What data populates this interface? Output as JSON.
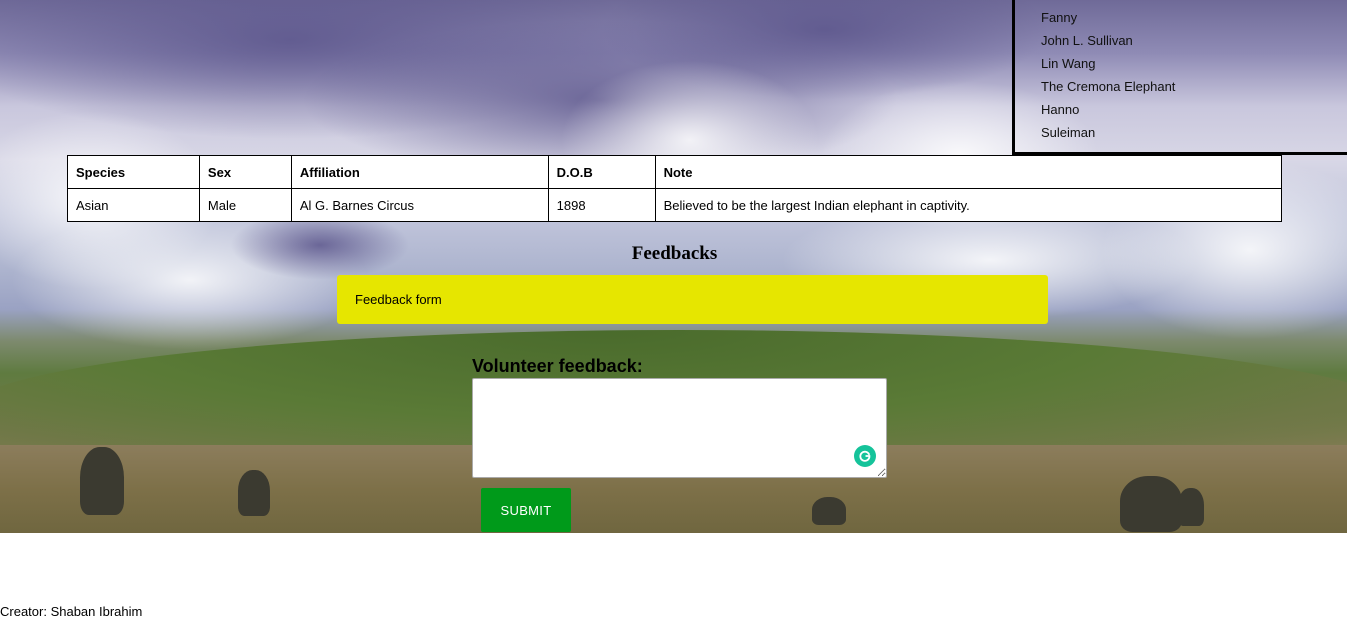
{
  "elephant_names": [
    "Fanny",
    "John L. Sullivan",
    "Lin Wang",
    "The Cremona Elephant",
    "Hanno",
    "Suleiman"
  ],
  "table": {
    "headers": [
      "Species",
      "Sex",
      "Affiliation",
      "D.O.B",
      "Note"
    ],
    "rows": [
      [
        "Asian",
        "Male",
        "Al G. Barnes Circus",
        "1898",
        "Believed to be the largest Indian elephant in captivity."
      ]
    ]
  },
  "feedback": {
    "heading": "Feedbacks",
    "banner_text": "Feedback form",
    "volunteer_label": "Volunteer feedback:",
    "textarea_value": "",
    "submit_label": "SUBMIT",
    "grammarly_icon": "grammarly-icon",
    "banner_color": "#e6e600",
    "submit_color": "#009a1a"
  },
  "footer": {
    "creator": "Creator: Shaban Ibrahim"
  }
}
